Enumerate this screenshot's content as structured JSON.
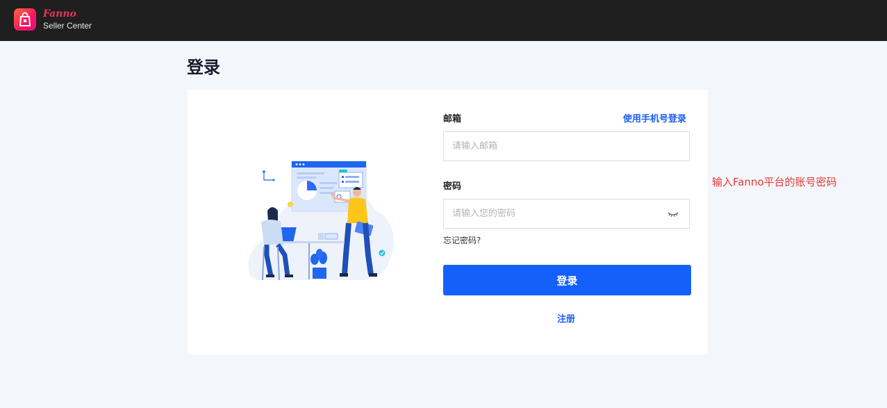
{
  "header": {
    "brand_name": "Fanno",
    "brand_sub": "Seller Center",
    "logo_icon": "shopping-bag-icon"
  },
  "page": {
    "title": "登录"
  },
  "form": {
    "email_label": "邮箱",
    "phone_login_link": "使用手机号登录",
    "email_placeholder": "请输入邮箱",
    "email_value": "",
    "password_label": "密码",
    "password_placeholder": "请输入您的密码",
    "password_value": "",
    "password_toggle_icon": "eye-closed-icon",
    "forgot_password": "忘记密码?",
    "submit_label": "登录",
    "register_link": "注册"
  },
  "annotation": {
    "text": "输入Fanno平台的账号密码"
  },
  "colors": {
    "topbar": "#1f1f1f",
    "background": "#f3f6fa",
    "accent": "#1360fb",
    "annotation": "#e53935"
  }
}
